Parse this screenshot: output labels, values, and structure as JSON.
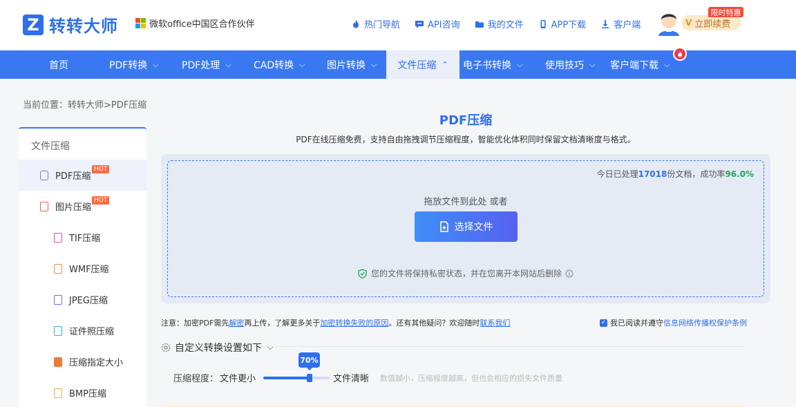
{
  "brand": {
    "logo_letter": "Z",
    "name": "转转大师",
    "partner": "微软office中国区合作伙伴"
  },
  "top_links": [
    {
      "label": "热门导航",
      "icon": "fire-icon"
    },
    {
      "label": "API咨询",
      "icon": "chat-icon"
    },
    {
      "label": "我的文件",
      "icon": "folder-icon"
    },
    {
      "label": "APP下载",
      "icon": "phone-icon"
    },
    {
      "label": "客户端",
      "icon": "download-icon"
    }
  ],
  "account": {
    "renew_label": "立即续费",
    "renew_mark": "V",
    "promo_badge": "限时特惠"
  },
  "nav": [
    {
      "label": "首页",
      "chevron": ""
    },
    {
      "label": "PDF转换",
      "chevron": "⌵"
    },
    {
      "label": "PDF处理",
      "chevron": "⌵"
    },
    {
      "label": "CAD转换",
      "chevron": "⌵"
    },
    {
      "label": "图片转换",
      "chevron": "⌵"
    },
    {
      "label": "文件压缩",
      "chevron": "⌃"
    },
    {
      "label": "电子书转换",
      "chevron": "⌵"
    },
    {
      "label": "使用技巧",
      "chevron": "⌵"
    },
    {
      "label": "客户端下载",
      "chevron": "⌵"
    }
  ],
  "breadcrumb": "当前位置：转转大师>PDF压缩",
  "sidebar": {
    "title": "文件压缩",
    "items": [
      {
        "label": "PDF压缩",
        "badge": "HOT",
        "color": "#8a6fd8"
      },
      {
        "label": "图片压缩",
        "badge": "HOT",
        "color": "#ef5a5a"
      },
      {
        "label": "TIF压缩",
        "badge": "",
        "color": "#d64cb0"
      },
      {
        "label": "WMF压缩",
        "badge": "",
        "color": "#f08a4b"
      },
      {
        "label": "JPEG压缩",
        "badge": "",
        "color": "#8a5ee0"
      },
      {
        "label": "证件照压缩",
        "badge": "",
        "color": "#2bb7c4"
      },
      {
        "label": "压缩指定大小",
        "badge": "",
        "color": "#f07a3a"
      },
      {
        "label": "BMP压缩",
        "badge": "",
        "color": "#f3a640"
      }
    ]
  },
  "main": {
    "title": "PDF压缩",
    "subtitle": "PDF在线压缩免费，支持自由拖拽调节压缩程度，智能优化体积同时保留文档清晰度与格式。",
    "stats": {
      "prefix": "今日已处理",
      "count": "17018",
      "mid": "份文档，成功率",
      "rate": "96.0%"
    },
    "drop_hint": "拖放文件到此处 或者",
    "choose_button": "选择文件",
    "privacy": "您的文件将保持私密状态，并在您离开本网站后删除"
  },
  "notice": {
    "p1": "注意：加密PDF需先",
    "link1": "解密",
    "p2": "再上传，了解更多关于",
    "link2": "加密转换失败的原因",
    "p3": "。还有其他疑问？欢迎随时",
    "link3": "联系我们"
  },
  "agree": {
    "text": "我已阅读并遵守",
    "link": "信息网络传播权保护条例",
    "checked": true
  },
  "settings": {
    "title": "自定义转换设置如下",
    "level_label": "压缩程度：",
    "low_label": "文件更小",
    "high_label": "文件清晰",
    "value_label": "70%",
    "value_fraction": 0.7,
    "hint": "数值越小，压缩程度越高，但也会相应的损失文件质量"
  },
  "colors": {
    "primary": "#2f6fec",
    "nav_bg": "#3a78f2",
    "success": "#21a656",
    "hot": "#ff6a3b"
  }
}
